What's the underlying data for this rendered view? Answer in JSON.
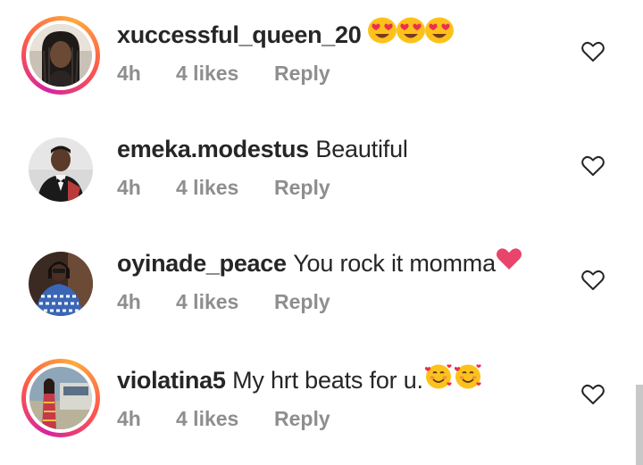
{
  "comments": [
    {
      "username": "xuccessful_queen_20",
      "text": "",
      "emojis": [
        "heart-eyes-emoji",
        "heart-eyes-emoji",
        "heart-eyes-emoji"
      ],
      "time": "4h",
      "likes": "4 likes",
      "reply": "Reply",
      "story_ring": true,
      "like_icon": "heart-outline-icon"
    },
    {
      "username": "emeka.modestus",
      "text": "Beautiful",
      "emojis": [],
      "time": "4h",
      "likes": "4 likes",
      "reply": "Reply",
      "story_ring": false,
      "like_icon": "heart-outline-icon"
    },
    {
      "username": "oyinade_peace",
      "text": "You rock it momma",
      "emojis": [
        "red-heart-emoji"
      ],
      "time": "4h",
      "likes": "4 likes",
      "reply": "Reply",
      "story_ring": false,
      "like_icon": "heart-outline-icon"
    },
    {
      "username": "violatina5",
      "text": "My hrt beats for u.",
      "emojis": [
        "smiling-face-with-hearts-emoji",
        "smiling-face-with-hearts-emoji"
      ],
      "time": "4h",
      "likes": "4 likes",
      "reply": "Reply",
      "story_ring": true,
      "like_icon": "heart-outline-icon"
    }
  ],
  "colors": {
    "primary_text": "#262626",
    "secondary_text": "#8e8e8e",
    "story_ring_gradient": [
      "#d6249f",
      "#fd5949",
      "#fdaa3d"
    ],
    "heart_emoji": "#e8456b",
    "scrollbar": "#c8c8c8"
  }
}
